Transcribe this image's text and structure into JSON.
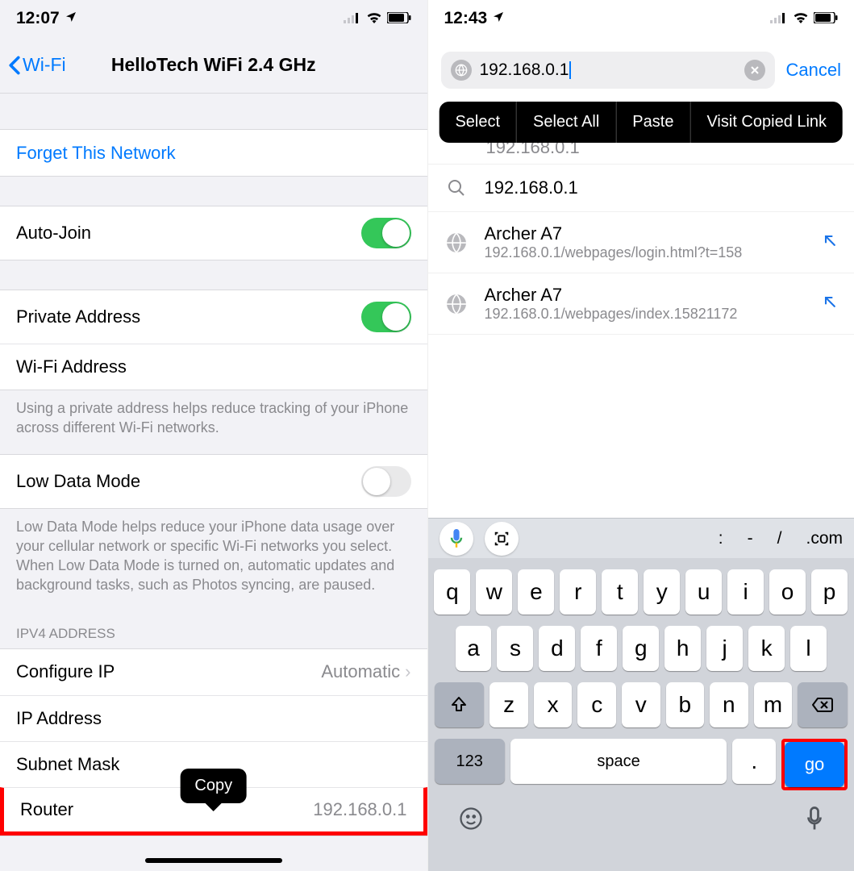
{
  "left": {
    "status": {
      "time": "12:07",
      "loc_icon": "location",
      "signal": "signal",
      "wifi": "wifi",
      "battery": "battery"
    },
    "nav": {
      "back": "Wi-Fi",
      "title": "HelloTech WiFi 2.4 GHz"
    },
    "forget": "Forget This Network",
    "auto_join": {
      "label": "Auto-Join",
      "on": true
    },
    "private_address": {
      "label": "Private Address",
      "on": true
    },
    "wifi_address": {
      "label": "Wi-Fi Address",
      "value": ""
    },
    "private_footer": "Using a private address helps reduce tracking of your iPhone across different Wi-Fi networks.",
    "low_data": {
      "label": "Low Data Mode",
      "on": false
    },
    "low_data_footer": "Low Data Mode helps reduce your iPhone data usage over your cellular network or specific Wi-Fi networks you select. When Low Data Mode is turned on, automatic updates and background tasks, such as Photos syncing, are paused.",
    "ipv4_header": "IPV4 ADDRESS",
    "configure_ip": {
      "label": "Configure IP",
      "value": "Automatic"
    },
    "ip_address": {
      "label": "IP Address",
      "value": ""
    },
    "subnet_mask": {
      "label": "Subnet Mask",
      "value": ""
    },
    "router": {
      "label": "Router",
      "value": "192.168.0.1"
    },
    "copy_popover": "Copy"
  },
  "right": {
    "status": {
      "time": "12:43",
      "loc_icon": "location",
      "signal": "signal",
      "wifi": "wifi",
      "battery": "battery"
    },
    "search": {
      "value": "192.168.0.1",
      "cancel": "Cancel"
    },
    "popover": {
      "select": "Select",
      "select_all": "Select All",
      "paste": "Paste",
      "visit": "Visit Copied Link"
    },
    "hidden_suggestion": "192.168.0.1",
    "suggestions": [
      {
        "type": "search",
        "title": "192.168.0.1",
        "subtitle": ""
      },
      {
        "type": "history",
        "title": "Archer A7",
        "subtitle": "192.168.0.1/webpages/login.html?t=158"
      },
      {
        "type": "history",
        "title": "Archer A7",
        "subtitle": "192.168.0.1/webpages/index.15821172"
      }
    ],
    "keyboard": {
      "quickbar": {
        "colon": ":",
        "dash": "-",
        "slash": "/",
        "dotcom": ".com"
      },
      "row1": [
        "q",
        "w",
        "e",
        "r",
        "t",
        "y",
        "u",
        "i",
        "o",
        "p"
      ],
      "row2": [
        "a",
        "s",
        "d",
        "f",
        "g",
        "h",
        "j",
        "k",
        "l"
      ],
      "row3": [
        "z",
        "x",
        "c",
        "v",
        "b",
        "n",
        "m"
      ],
      "num": "123",
      "space": "space",
      "dot": ".",
      "go": "go"
    }
  }
}
